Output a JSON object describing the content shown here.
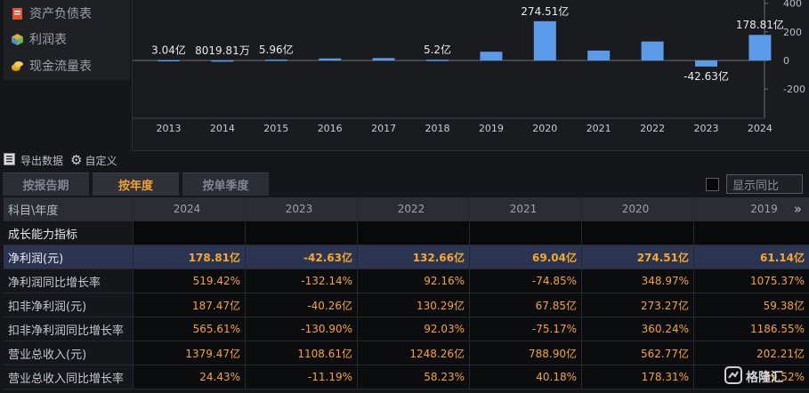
{
  "sidebar": {
    "items": [
      {
        "label": "资产负债表",
        "icon": "balance-sheet-icon",
        "color": "#e3542e"
      },
      {
        "label": "利润表",
        "icon": "cube-icon",
        "color": "#4a90d9"
      },
      {
        "label": "现金流量表",
        "icon": "coins-icon",
        "color": "#e3b02e"
      }
    ]
  },
  "toolbar": {
    "export_label": "导出数据",
    "custom_label": "自定义"
  },
  "tabs": [
    {
      "label": "按报告期",
      "active": false
    },
    {
      "label": "按年度",
      "active": true
    },
    {
      "label": "按单季度",
      "active": false
    }
  ],
  "yoy_toggle": {
    "label": "显示同比",
    "checked": false
  },
  "chart_data": {
    "type": "bar",
    "categories": [
      "2013",
      "2014",
      "2015",
      "2016",
      "2017",
      "2018",
      "2019",
      "2020",
      "2021",
      "2022",
      "2023",
      "2024"
    ],
    "values": [
      3.04,
      0.8,
      5.96,
      14.0,
      16.5,
      5.2,
      61.14,
      274.51,
      69.04,
      132.66,
      -42.63,
      178.81
    ],
    "data_labels": [
      "3.04亿",
      "8019.81万",
      "5.96亿",
      "",
      "",
      "5.2亿",
      "",
      "274.51亿",
      "",
      "",
      "-42.63亿",
      "178.81亿"
    ],
    "yticks": [
      400,
      200,
      0,
      -200
    ],
    "ylim": [
      -280,
      420
    ],
    "color": "#5b9ae8",
    "grid": false
  },
  "table": {
    "header": {
      "label": "科目\\年度",
      "years": [
        "2024",
        "2023",
        "2022",
        "2021",
        "2020",
        "2019"
      ]
    },
    "section_label": "成长能力指标",
    "rows": [
      {
        "label": "净利润(元)",
        "values": [
          "178.81亿",
          "-42.63亿",
          "132.66亿",
          "69.04亿",
          "274.51亿",
          "61.14亿"
        ],
        "highlight": true
      },
      {
        "label": "净利润同比增长率",
        "values": [
          "519.42%",
          "-132.14%",
          "92.16%",
          "-74.85%",
          "348.97%",
          "1075.37%"
        ]
      },
      {
        "label": "扣非净利润(元)",
        "values": [
          "187.47亿",
          "-40.26亿",
          "130.29亿",
          "67.85亿",
          "273.27亿",
          "59.38亿"
        ]
      },
      {
        "label": "扣非净利润同比增长率",
        "values": [
          "565.61%",
          "-130.90%",
          "92.03%",
          "-75.17%",
          "360.24%",
          "1186.55%"
        ]
      },
      {
        "label": "营业总收入(元)",
        "values": [
          "1379.47亿",
          "1108.61亿",
          "1248.26亿",
          "788.90亿",
          "562.77亿",
          "202.21亿"
        ]
      },
      {
        "label": "营业总收入同比增长率",
        "values": [
          "24.43%",
          "-11.19%",
          "58.23%",
          "40.18%",
          "178.31%",
          "39.52%"
        ]
      }
    ]
  },
  "watermark": {
    "text": "格隆汇"
  }
}
